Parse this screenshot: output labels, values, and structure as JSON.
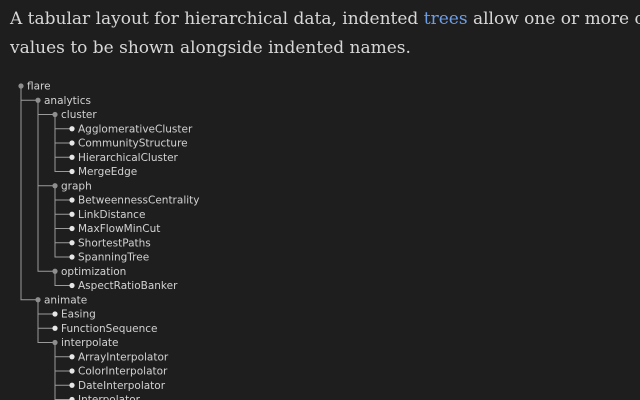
{
  "intro": {
    "before": "A tabular layout for hierarchical data, indented ",
    "link_text": "trees",
    "after_line1": " allow one or more columns of",
    "line2": "values to be shown alongside indented names."
  },
  "tree": {
    "name": "flare",
    "children": [
      {
        "name": "analytics",
        "children": [
          {
            "name": "cluster",
            "children": [
              {
                "name": "AgglomerativeCluster"
              },
              {
                "name": "CommunityStructure"
              },
              {
                "name": "HierarchicalCluster"
              },
              {
                "name": "MergeEdge"
              }
            ]
          },
          {
            "name": "graph",
            "children": [
              {
                "name": "BetweennessCentrality"
              },
              {
                "name": "LinkDistance"
              },
              {
                "name": "MaxFlowMinCut"
              },
              {
                "name": "ShortestPaths"
              },
              {
                "name": "SpanningTree"
              }
            ]
          },
          {
            "name": "optimization",
            "children": [
              {
                "name": "AspectRatioBanker"
              }
            ]
          }
        ]
      },
      {
        "name": "animate",
        "children": [
          {
            "name": "Easing"
          },
          {
            "name": "FunctionSequence"
          },
          {
            "name": "interpolate",
            "children": [
              {
                "name": "ArrayInterpolator"
              },
              {
                "name": "ColorInterpolator"
              },
              {
                "name": "DateInterpolator"
              },
              {
                "name": "Interpolator"
              }
            ]
          }
        ]
      }
    ]
  }
}
